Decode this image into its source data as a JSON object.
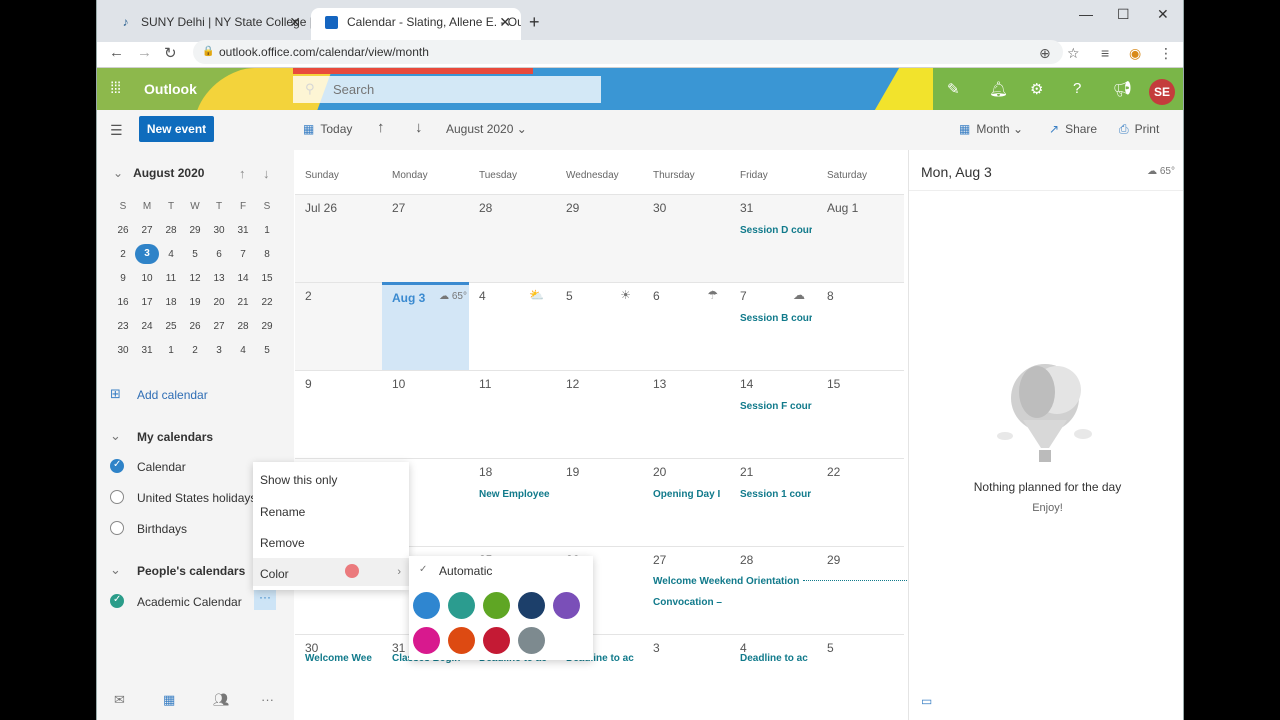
{
  "browser": {
    "tabs": [
      {
        "label": "SUNY Delhi | NY State College | U"
      },
      {
        "label": "Calendar - Slating, Allene E. - Ou"
      }
    ],
    "url": "outlook.office.com/calendar/view/month"
  },
  "header": {
    "brand": "Outlook",
    "search_placeholder": "Search",
    "avatar": "SE"
  },
  "commandbar": {
    "new_event": "New event",
    "today": "Today",
    "month_label": "August 2020",
    "view": "Month",
    "share": "Share",
    "print": "Print"
  },
  "minical": {
    "title": "August 2020",
    "headers": [
      "S",
      "M",
      "T",
      "W",
      "T",
      "F",
      "S"
    ],
    "weeks": [
      [
        "26",
        "27",
        "28",
        "29",
        "30",
        "31",
        "1"
      ],
      [
        "2",
        "3",
        "4",
        "5",
        "6",
        "7",
        "8"
      ],
      [
        "9",
        "10",
        "11",
        "12",
        "13",
        "14",
        "15"
      ],
      [
        "16",
        "17",
        "18",
        "19",
        "20",
        "21",
        "22"
      ],
      [
        "23",
        "24",
        "25",
        "26",
        "27",
        "28",
        "29"
      ],
      [
        "30",
        "31",
        "1",
        "2",
        "3",
        "4",
        "5"
      ]
    ],
    "selected": "3"
  },
  "leftpane": {
    "add_calendar": "Add calendar",
    "my_calendars": "My calendars",
    "calendars": [
      "Calendar",
      "United States holidays",
      "Birthdays"
    ],
    "peoples_calendars": "People's calendars",
    "academic": "Academic Calendar",
    "dots": "···"
  },
  "calendar": {
    "days": [
      "Sunday",
      "Monday",
      "Tuesday",
      "Wednesday",
      "Thursday",
      "Friday",
      "Saturday"
    ],
    "weeks": [
      [
        "Jul 26",
        "27",
        "28",
        "29",
        "30",
        "31",
        "Aug 1"
      ],
      [
        "2",
        "Aug 3",
        "4",
        "5",
        "6",
        "7",
        "8"
      ],
      [
        "9",
        "10",
        "11",
        "12",
        "13",
        "14",
        "15"
      ],
      [
        "",
        "",
        "18",
        "19",
        "20",
        "21",
        "22"
      ],
      [
        "",
        "",
        "25",
        "26",
        "27",
        "28",
        "29"
      ],
      [
        "30",
        "31",
        "",
        "",
        "3",
        "4",
        "5"
      ]
    ],
    "today_temp": "65°",
    "events": {
      "w0_fri": "Session D cour",
      "w1_fri": "Session B cour",
      "w2_fri": "Session F cour",
      "w3_tue": "New Employee",
      "w3_thu": "Opening Day I",
      "w3_fri": "Session 1 cour",
      "w4_span": "Welcome Weekend Orientation",
      "w4_convo": "Convocation –",
      "w5_sun": "Welcome Wee",
      "w5_mon": "Classes Begin",
      "w5_tue": "Deadline to ac",
      "w5_wed": "Deadline to ac",
      "w5_fri": "Deadline to ac"
    }
  },
  "rightpane": {
    "date": "Mon, Aug 3",
    "temp": "65°",
    "nothing": "Nothing planned for the day",
    "enjoy": "Enjoy!"
  },
  "context_menu": {
    "items": [
      "Show this only",
      "Rename",
      "Remove",
      "Color"
    ]
  },
  "color_menu": {
    "automatic": "Automatic",
    "swatches": [
      "#2f86d0",
      "#2b9c8f",
      "#5fa624",
      "#1c3f6a",
      "#7a4fb8",
      "#d8198e",
      "#dd4a12",
      "#c41a34",
      "#7d8a8f"
    ]
  }
}
